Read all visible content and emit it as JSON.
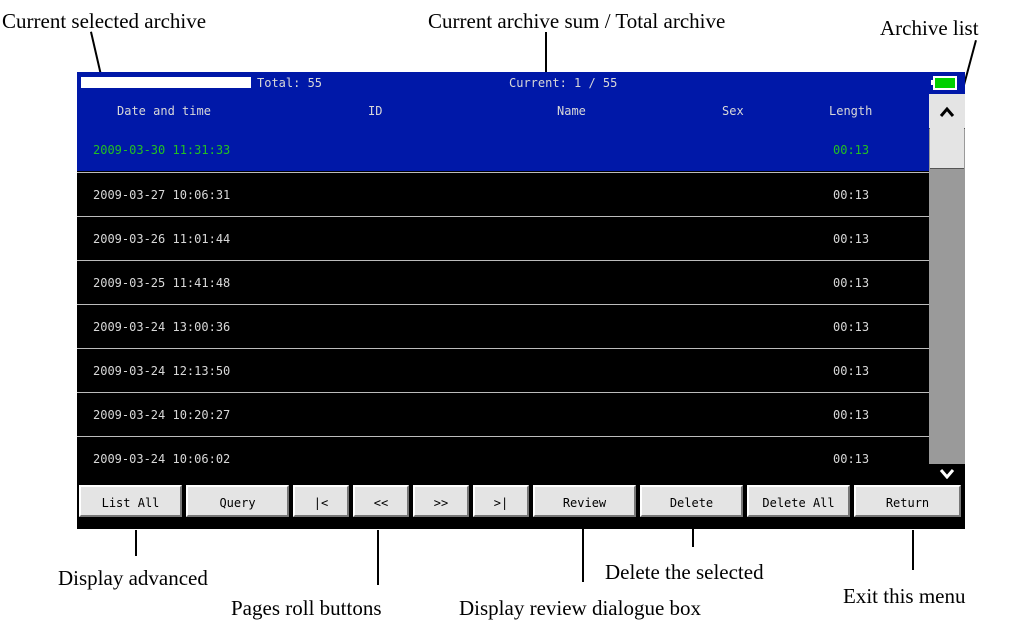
{
  "callouts": {
    "current_selected_archive": "Current selected archive",
    "current_sum_total": "Current archive sum / Total archive",
    "archive_list": "Archive list",
    "display_advanced": "Display advanced",
    "pages_roll_buttons": "Pages roll buttons",
    "display_review": "Display review dialogue box",
    "delete_selected": "Delete the selected",
    "exit_menu": "Exit this menu"
  },
  "header": {
    "total": "Total: 55",
    "current": "Current: 1 / 55"
  },
  "columns": {
    "date": "Date and time",
    "id": "ID",
    "name": "Name",
    "sex": "Sex",
    "length": "Length"
  },
  "rows": [
    {
      "date": "2009-03-30 11:31:33",
      "id": "",
      "name": "",
      "sex": "",
      "length": "00:13",
      "selected": true
    },
    {
      "date": "2009-03-27 10:06:31",
      "id": "",
      "name": "",
      "sex": "",
      "length": "00:13"
    },
    {
      "date": "2009-03-26 11:01:44",
      "id": "",
      "name": "",
      "sex": "",
      "length": "00:13"
    },
    {
      "date": "2009-03-25 11:41:48",
      "id": "",
      "name": "",
      "sex": "",
      "length": "00:13"
    },
    {
      "date": "2009-03-24 13:00:36",
      "id": "",
      "name": "",
      "sex": "",
      "length": "00:13"
    },
    {
      "date": "2009-03-24 12:13:50",
      "id": "",
      "name": "",
      "sex": "",
      "length": "00:13"
    },
    {
      "date": "2009-03-24 10:20:27",
      "id": "",
      "name": "",
      "sex": "",
      "length": "00:13"
    },
    {
      "date": "2009-03-24 10:06:02",
      "id": "",
      "name": "",
      "sex": "",
      "length": "00:13"
    }
  ],
  "buttons": {
    "list_all": "List All",
    "query": "Query",
    "first": "|<",
    "prev": "<<",
    "next": ">>",
    "last": ">|",
    "review": "Review",
    "delete": "Delete",
    "delete_all": "Delete All",
    "return": "Return"
  },
  "icons": {
    "scroll_up": "chevron-up-icon",
    "scroll_down": "chevron-down-icon",
    "battery": "battery-icon"
  },
  "colors": {
    "header_bg": "#0018a8",
    "selected_text": "#22c022",
    "list_bg": "#000000",
    "button_face": "#e4e4e4"
  }
}
